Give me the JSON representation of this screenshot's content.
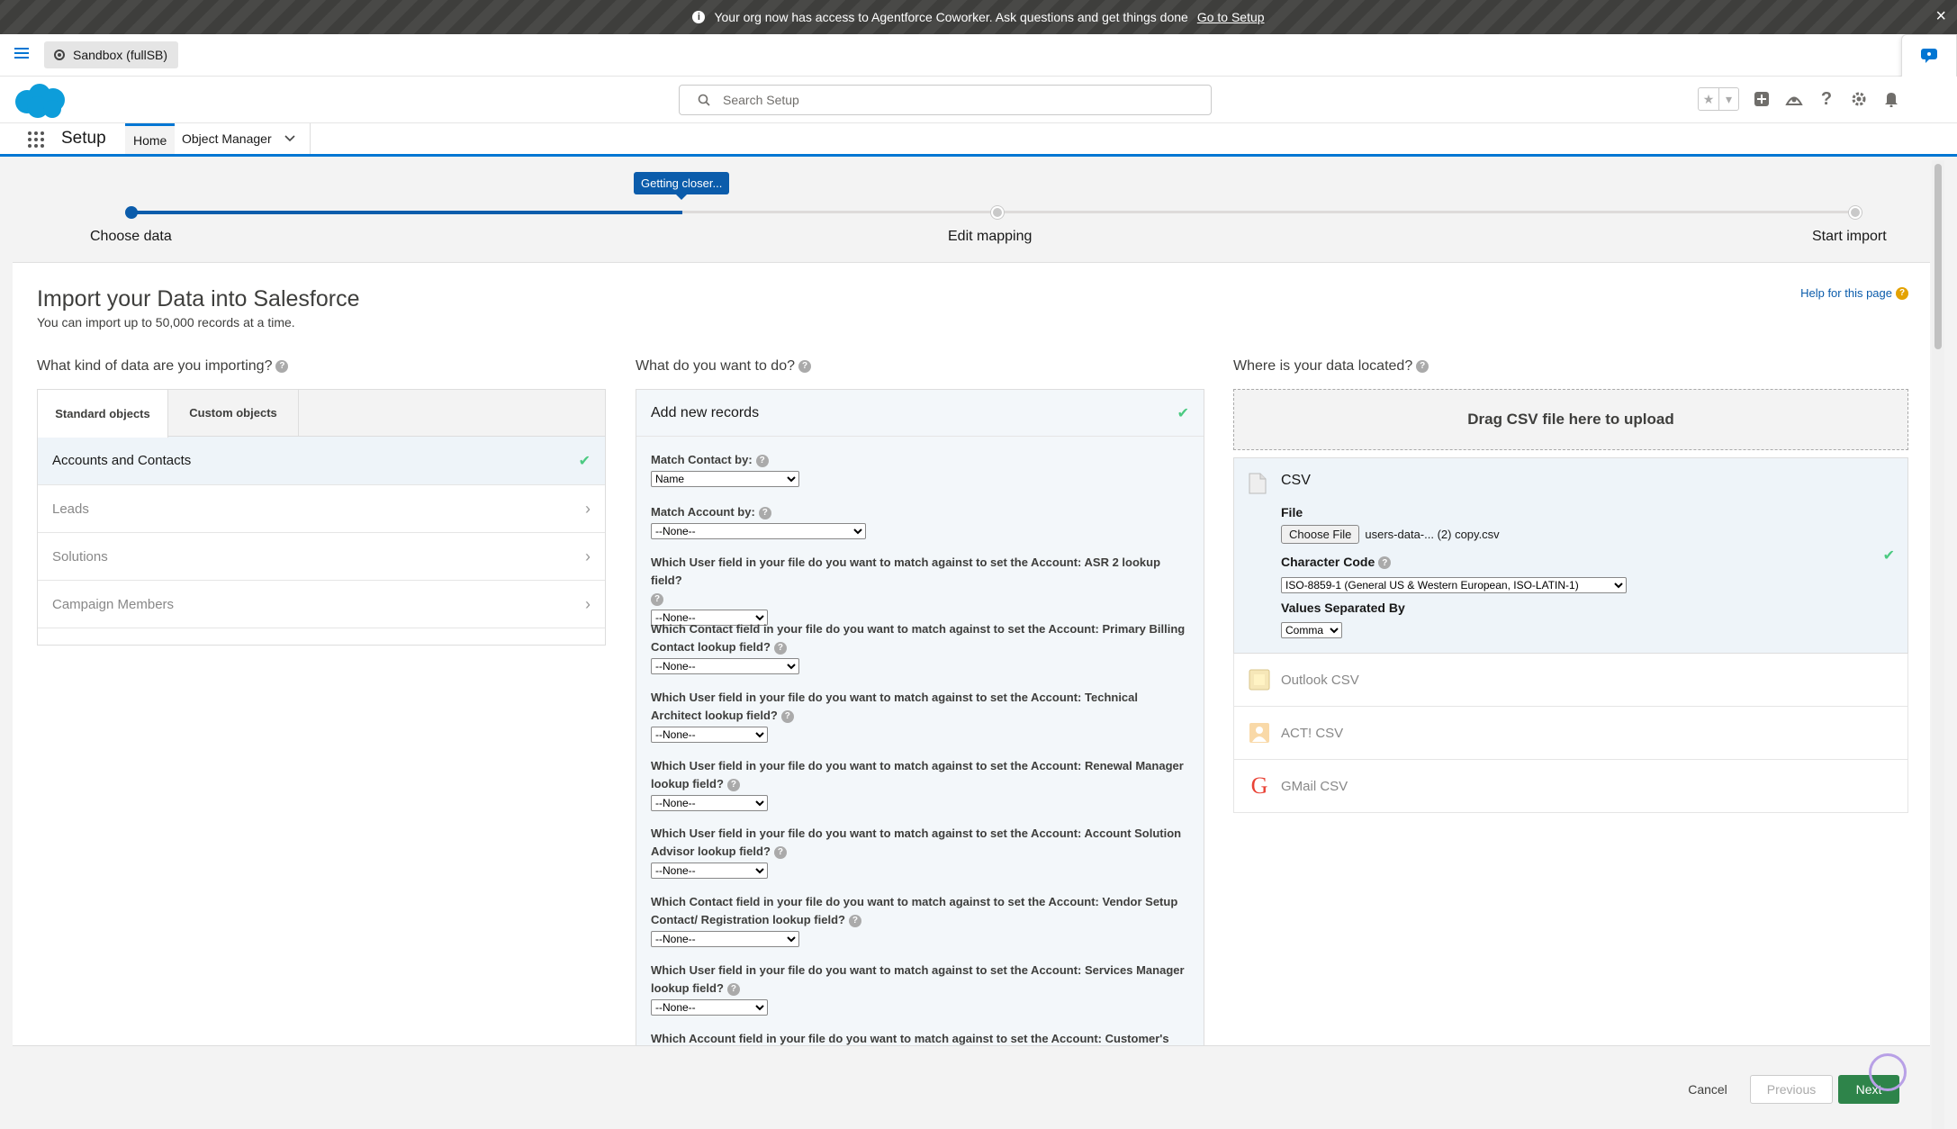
{
  "banner": {
    "text": "Your org now has access to Agentforce Coworker. Ask questions and get things done",
    "link": "Go to Setup"
  },
  "context": {
    "sandbox": "Sandbox (fullSB)"
  },
  "header": {
    "search_placeholder": "Search Setup"
  },
  "nav": {
    "app": "Setup",
    "tabs": [
      "Home",
      "Object Manager"
    ]
  },
  "progress": {
    "tooltip": "Getting closer...",
    "steps": [
      "Choose data",
      "Edit mapping",
      "Start import"
    ],
    "fraction": 0.32
  },
  "page": {
    "title": "Import your Data into Salesforce",
    "subtitle": "You can import up to 50,000 records at a time.",
    "help": "Help for this page"
  },
  "col1": {
    "heading": "What kind of data are you importing?",
    "tabs": [
      "Standard objects",
      "Custom objects"
    ],
    "objects": [
      "Accounts and Contacts",
      "Leads",
      "Solutions",
      "Campaign Members"
    ]
  },
  "col2": {
    "heading": "What do you want to do?",
    "action": "Add new records",
    "fields": [
      {
        "q": "Match Contact by:",
        "v": "Name"
      },
      {
        "q": "Match Account by:",
        "v": "--None--"
      },
      {
        "q": "Which User field in your file do you want to match against to set the Account: ASR 2 lookup field?",
        "v": "--None--"
      },
      {
        "q": "Which Contact field in your file do you want to match against to set the Account: Primary Billing Contact lookup field?",
        "v": "--None--"
      },
      {
        "q": "Which User field in your file do you want to match against to set the Account: Technical Architect lookup field?",
        "v": "--None--"
      },
      {
        "q": "Which User field in your file do you want to match against to set the Account: Renewal Manager lookup field?",
        "v": "--None--"
      },
      {
        "q": "Which User field in your file do you want to match against to set the Account: Account Solution Advisor lookup field?",
        "v": "--None--"
      },
      {
        "q": "Which Contact field in your file do you want to match against to set the Account: Vendor Setup Contact/ Registration lookup field?",
        "v": "--None--"
      },
      {
        "q": "Which User field in your file do you want to match against to set the Account: Services Manager lookup field?",
        "v": "--None--"
      },
      {
        "q": "Which Account field in your file do you want to match against to set the Account: Customer's",
        "v": ""
      }
    ]
  },
  "col3": {
    "heading": "Where is your data located?",
    "drop": "Drag CSV file here to upload",
    "csv_title": "CSV",
    "file_label": "File",
    "choose_file": "Choose File",
    "file_name": "users-data-... (2) copy.csv",
    "charset_label": "Character Code",
    "charset_value": "ISO-8859-1 (General US & Western European, ISO-LATIN-1)",
    "separator_label": "Values Separated By",
    "separator_value": "Comma",
    "sources": [
      "Outlook CSV",
      "ACT! CSV",
      "GMail CSV"
    ]
  },
  "footer": {
    "cancel": "Cancel",
    "previous": "Previous",
    "next": "Next"
  },
  "colors": {
    "brand": "#0176d3",
    "progress": "#0b5cab",
    "next": "#2e844a",
    "check": "#4bca81"
  }
}
